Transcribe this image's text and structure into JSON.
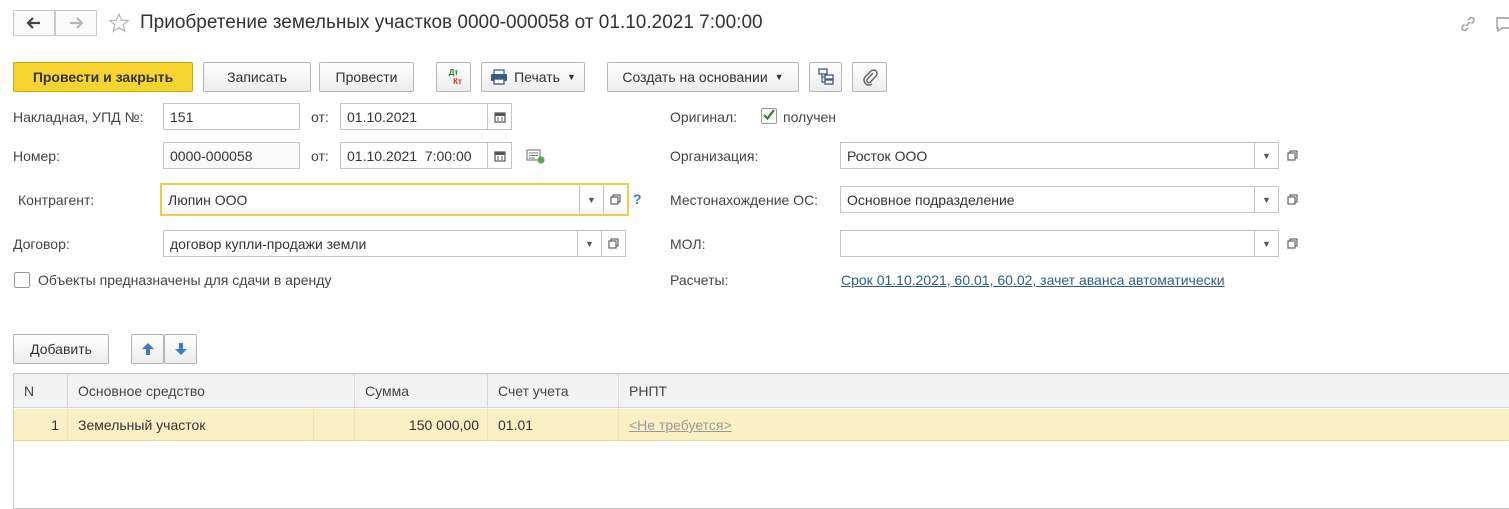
{
  "header": {
    "title": "Приобретение земельных участков 0000-000058 от 01.10.2021 7:00:00"
  },
  "toolbar": {
    "post_and_close": "Провести и закрыть",
    "save": "Записать",
    "post": "Провести",
    "dt_kt_top": "Дт",
    "dt_kt_bottom": "Кт",
    "print": "Печать",
    "create_based_on": "Создать на основании"
  },
  "form": {
    "invoice_label": "Накладная, УПД №:",
    "invoice_number": "151",
    "from_label": "от:",
    "invoice_date": "01.10.2021",
    "number_label": "Номер:",
    "number": "0000-000058",
    "from_label_2": "от:",
    "number_datetime": "01.10.2021  7:00:00",
    "counterparty_label": "Контрагент:",
    "counterparty": "Люпин ООО",
    "help_mark": "?",
    "contract_label": "Договор:",
    "contract": "договор купли-продажи земли",
    "rental_checkbox_label": "Объекты предназначены для сдачи в аренду",
    "original_label": "Оригинал:",
    "original_received_label": "получен",
    "original_received": true,
    "organization_label": "Организация:",
    "organization": "Росток ООО",
    "location_label": "Местонахождение ОС:",
    "location": "Основное подразделение",
    "mol_label": "МОЛ:",
    "mol": "",
    "settlements_label": "Расчеты:",
    "settlements_link": "Срок 01.10.2021, 60.01, 60.02, зачет аванса автоматически"
  },
  "table_toolbar": {
    "add": "Добавить"
  },
  "table": {
    "columns": [
      "N",
      "Основное средство",
      "Сумма",
      "Счет учета",
      "РНПТ"
    ],
    "rows": [
      {
        "n": "1",
        "asset": "Земельный участок",
        "sum": "150 000,00",
        "account": "01.01",
        "rnpt": "<Не требуется>"
      }
    ]
  },
  "colors": {
    "primary_button": "#f7d430",
    "selected_row": "#fbf0c4",
    "link": "#2b5d8e",
    "focus_border": "#f2c94c"
  },
  "icons": [
    "back-arrow-icon",
    "forward-arrow-icon",
    "star-icon",
    "link-icon",
    "printer-icon",
    "structure-icon",
    "paperclip-icon",
    "calendar-icon",
    "comment-icon",
    "checkmark-icon",
    "open-icon",
    "arrow-up-icon",
    "arrow-down-icon"
  ]
}
